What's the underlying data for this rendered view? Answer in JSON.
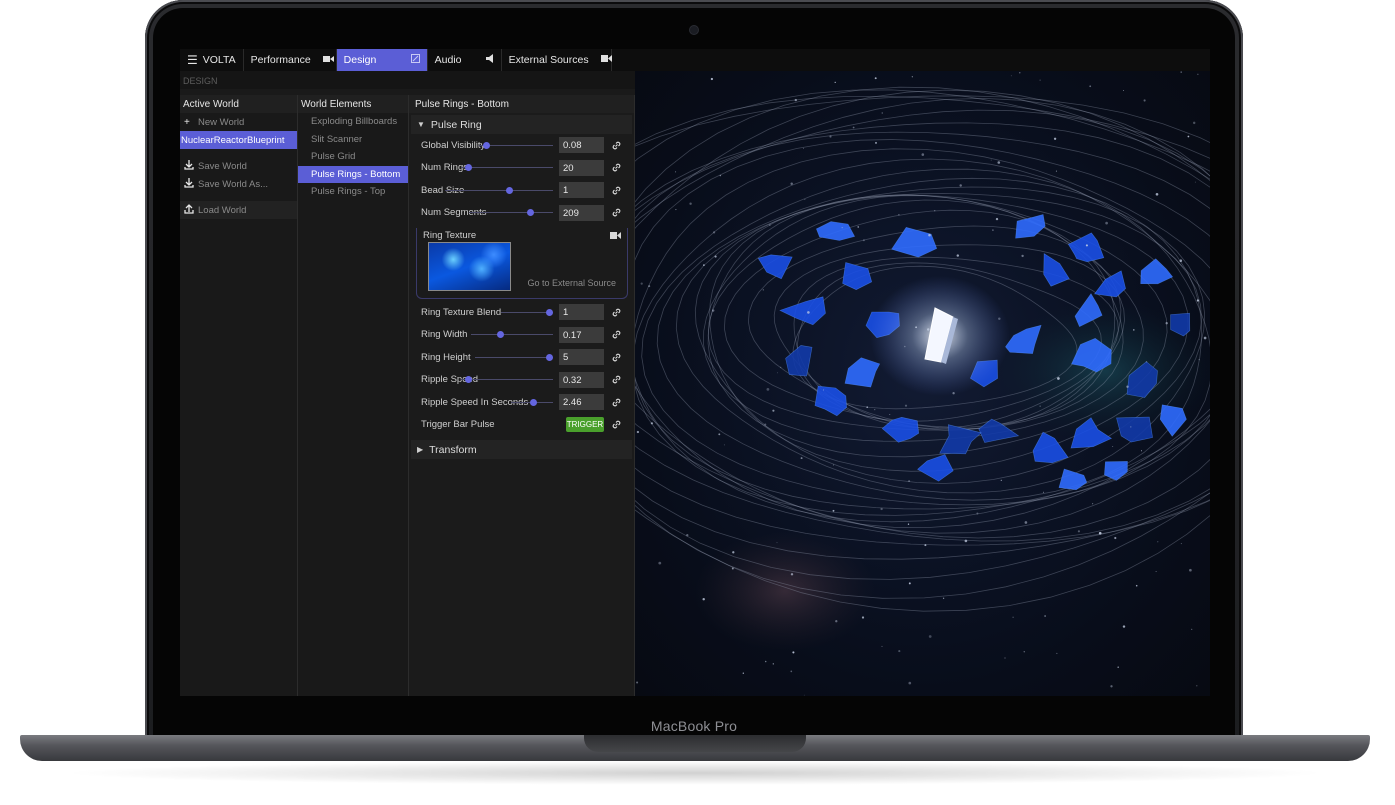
{
  "device": {
    "brand_label": "MacBook Pro"
  },
  "topbar": {
    "app_name": "VOLTA",
    "tabs": [
      {
        "label": "Performance",
        "icon": "video-camera-icon"
      },
      {
        "label": "Design",
        "icon": "edit-icon",
        "active": true
      },
      {
        "label": "Audio",
        "icon": "speaker-icon"
      },
      {
        "label": "External Sources",
        "icon": "video-icon"
      }
    ]
  },
  "section_label": "DESIGN",
  "world_panel": {
    "title": "Active World",
    "new_world": "New World",
    "current_world": "NuclearReactorBlueprint",
    "save_world": "Save World",
    "save_world_as": "Save World As...",
    "load_world": "Load World"
  },
  "elements_panel": {
    "title": "World Elements",
    "items": [
      "Exploding Billboards",
      "Slit Scanner",
      "Pulse Grid",
      "Pulse Rings - Bottom",
      "Pulse Rings - Top"
    ],
    "selected": "Pulse Rings - Bottom"
  },
  "properties_panel": {
    "title": "Pulse Rings - Bottom",
    "section_pulse_ring": "Pulse Ring",
    "section_transform": "Transform",
    "props": [
      {
        "label": "Global Visibility",
        "value": "0.08",
        "level": 0.06
      },
      {
        "label": "Num Rings",
        "value": "20",
        "level": 0.05
      },
      {
        "label": "Bead Size",
        "value": "1",
        "level": 0.6
      },
      {
        "label": "Num Segments",
        "value": "209",
        "level": 0.75
      },
      {
        "label": "Ring Texture Blend",
        "value": "1",
        "level": 1.0
      },
      {
        "label": "Ring Width",
        "value": "0.17",
        "level": 0.35
      },
      {
        "label": "Ring Height",
        "value": "5",
        "level": 1.0
      },
      {
        "label": "Ripple Speed",
        "value": "0.32",
        "level": 0.05
      },
      {
        "label": "Ripple Speed In Seconds",
        "value": "2.46",
        "level": 0.55
      }
    ],
    "ring_texture": {
      "title": "Ring Texture",
      "link_label": "Go to External Source"
    },
    "trigger": {
      "label": "Trigger Bar Pulse",
      "button": "TRIGGER"
    }
  },
  "colors": {
    "accent": "#5b5ed6",
    "trigger": "#4aa02c",
    "slider": "#6466e0"
  }
}
